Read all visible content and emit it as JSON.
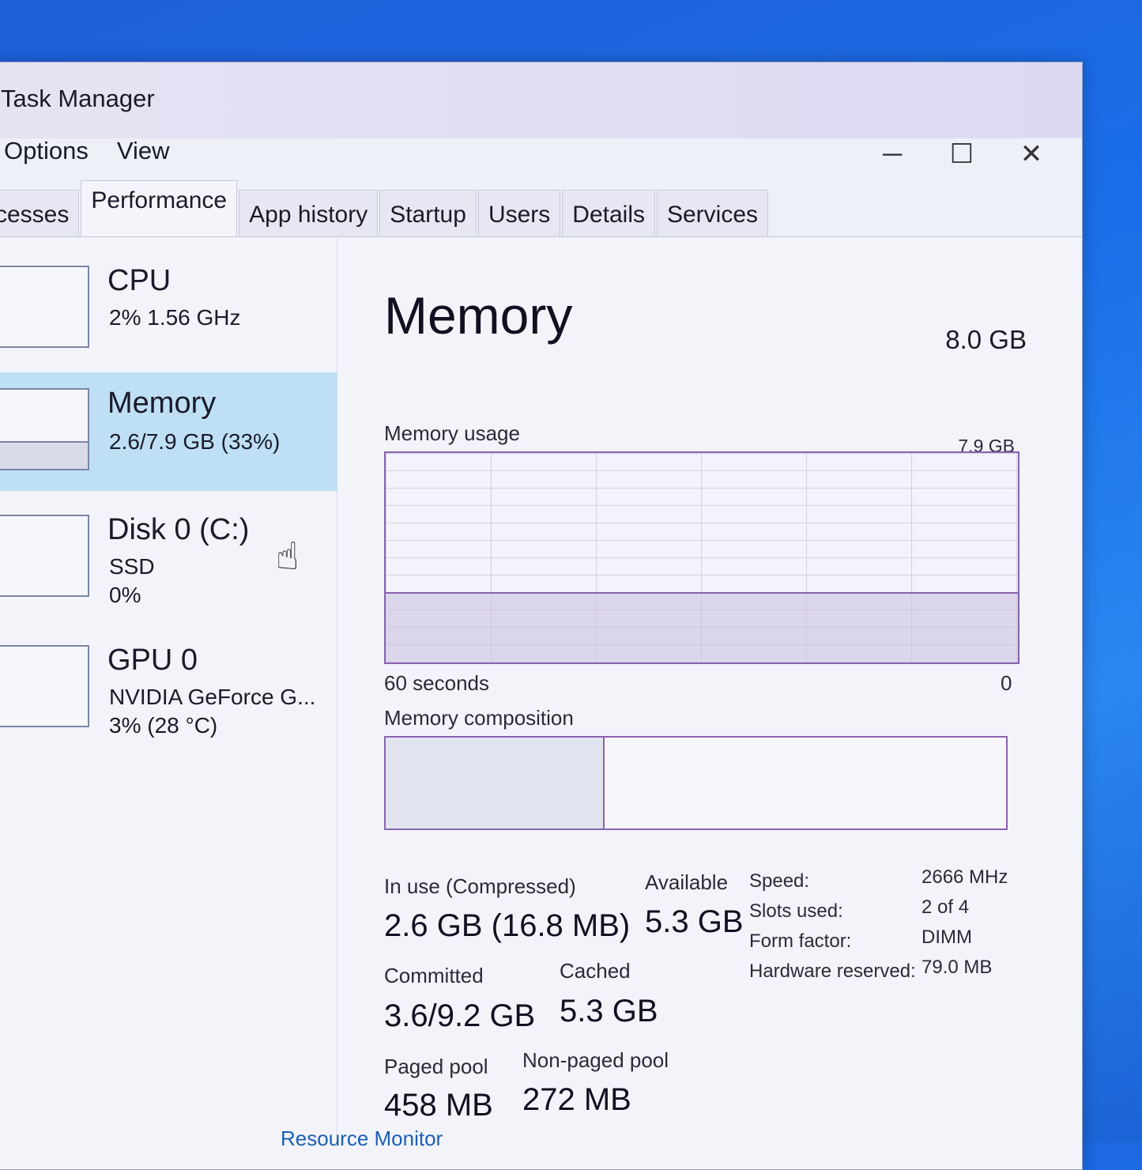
{
  "window": {
    "title": "Task Manager",
    "controls": {
      "minimize": "─",
      "maximize": "☐",
      "close": "✕"
    }
  },
  "menu": {
    "items": [
      "Options",
      "View"
    ]
  },
  "tabs": [
    "cesses",
    "Performance",
    "App history",
    "Startup",
    "Users",
    "Details",
    "Services"
  ],
  "active_tab": "Performance",
  "sidebar": {
    "cpu": {
      "name": "CPU",
      "sub": "2% 1.56 GHz"
    },
    "memory": {
      "name": "Memory",
      "sub": "2.6/7.9 GB (33%)"
    },
    "disk": {
      "name": "Disk 0 (C:)",
      "sub1": "SSD",
      "sub2": "0%"
    },
    "gpu": {
      "name": "GPU 0",
      "sub1": "NVIDIA GeForce G...",
      "sub2": "3% (28 °C)"
    }
  },
  "main": {
    "title": "Memory",
    "total": "8.0 GB",
    "usage_label": "Memory usage",
    "usage_max": "7.9 GB",
    "axis_left": "60 seconds",
    "axis_right": "0",
    "usage_fraction": 0.33,
    "composition_label": "Memory composition",
    "composition_inuse_fraction": 0.35,
    "stats": {
      "in_use_label": "In use (Compressed)",
      "in_use_value": "2.6 GB (16.8 MB)",
      "available_label": "Available",
      "available_value": "5.3 GB",
      "committed_label": "Committed",
      "committed_value": "3.6/9.2 GB",
      "cached_label": "Cached",
      "cached_value": "5.3 GB",
      "paged_label": "Paged pool",
      "paged_value": "458 MB",
      "nonpaged_label": "Non-paged pool",
      "nonpaged_value": "272 MB"
    },
    "specs": {
      "speed_label": "Speed:",
      "speed_value": "2666 MHz",
      "slots_label": "Slots used:",
      "slots_value": "2 of 4",
      "form_label": "Form factor:",
      "form_value": "DIMM",
      "hw_label": "Hardware reserved:",
      "hw_value": "79.0 MB"
    }
  },
  "footer": {
    "link": "Resource Monitor"
  },
  "colors": {
    "accent": "#8a62b0",
    "selected": "#bfe0f4"
  }
}
